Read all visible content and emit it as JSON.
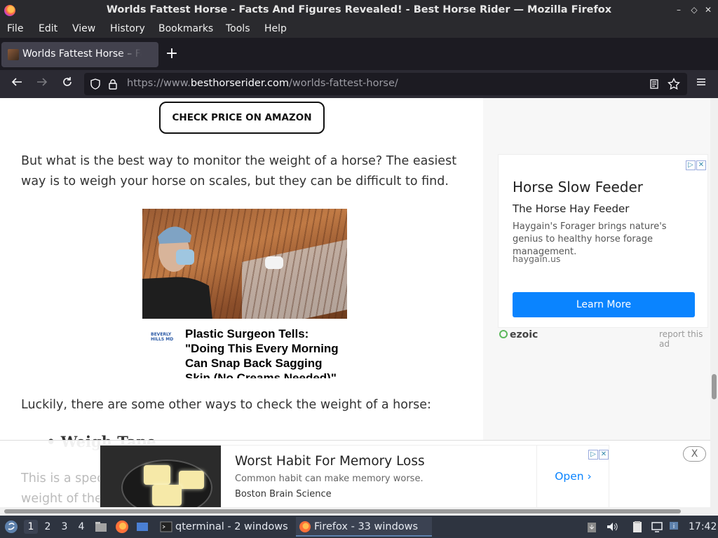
{
  "window": {
    "title": "Worlds Fattest Horse - Facts And Figures Revealed! - Best Horse Rider — Mozilla Firefox",
    "minimize": "–",
    "maximize": "◇",
    "close": "✕"
  },
  "menu": {
    "file": "File",
    "edit": "Edit",
    "view": "View",
    "history": "History",
    "bookmarks": "Bookmarks",
    "tools": "Tools",
    "help": "Help"
  },
  "tab": {
    "title": "Worlds Fattest Horse – Facts And Figures Revealed!",
    "new_tab": "+"
  },
  "nav": {
    "url_prefix": "https://www.",
    "url_domain": "besthorserider.com",
    "url_path": "/worlds-fattest-horse/"
  },
  "page": {
    "amazon_button": "CHECK PRICE ON AMAZON",
    "para1_line1": "But what is the best way to monitor the weight of a horse? The easiest",
    "para1_line2": "way is to weigh your horse on scales, but they can be difficult to find.",
    "native_ad_headline": "Plastic Surgeon Tells: \"Doing This Every Morning Can Snap Back Sagging Skin (No Creams Needed)\"",
    "native_ad_logo": "BEVERLY HILLS MD",
    "para2": "Luckily, there are some other ways to check the weight of a horse:",
    "bullet": "• Weigh Tape",
    "behind_line1": "This is a spec",
    "behind_line2": "weight of the"
  },
  "sidebar_ad": {
    "title": "Horse Slow Feeder",
    "subtitle": "The Horse Hay Feeder",
    "description": "Haygain's Forager brings nature's genius to healthy horse forage management.",
    "domain": "haygain.us",
    "button": "Learn More",
    "brand": "ezoic",
    "report": "report this ad"
  },
  "sticky_ad": {
    "title": "Worst Habit For Memory Loss",
    "description": "Common habit can make memory worse.",
    "advertiser": "Boston Brain Science",
    "open": "Open ›",
    "close": "X"
  },
  "taskbar": {
    "desktops": [
      "1",
      "2",
      "3",
      "4"
    ],
    "qterminal": "qterminal - 2 windows",
    "firefox": "Firefox - 33 windows",
    "clock": "17:42"
  }
}
